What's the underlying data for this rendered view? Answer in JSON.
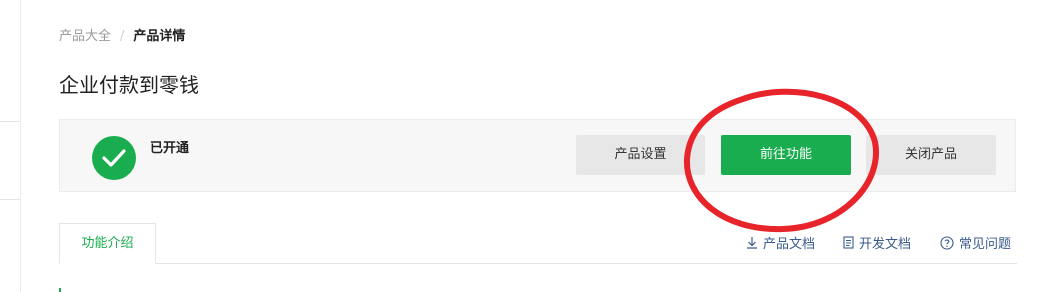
{
  "breadcrumb": {
    "parent": "产品大全",
    "separator": "/",
    "current": "产品详情"
  },
  "title": "企业付款到零钱",
  "status": {
    "text": "已开通",
    "icon": "check-circle-icon"
  },
  "actions": {
    "settings_label": "产品设置",
    "goto_label": "前往功能",
    "close_label": "关闭产品"
  },
  "tabs": [
    {
      "label": "功能介绍",
      "active": true
    }
  ],
  "doc_links": [
    {
      "label": "产品文档",
      "icon": "download-icon"
    },
    {
      "label": "开发文档",
      "icon": "document-icon"
    },
    {
      "label": "常见问题",
      "icon": "question-icon"
    }
  ],
  "colors": {
    "brand_green": "#1aad4f",
    "annotation_red": "#e8242b",
    "link_blue": "#3a5b8c"
  }
}
